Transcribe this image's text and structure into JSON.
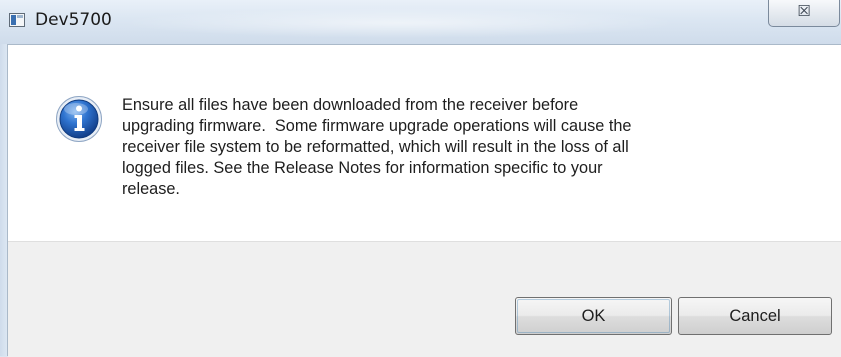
{
  "window": {
    "title": "Dev5700",
    "close_glyph": "☒",
    "app_icon": "application-window-icon"
  },
  "dialog": {
    "icon": "information-icon",
    "message": "Ensure all files have been downloaded from the receiver before\nupgrading firmware.  Some firmware upgrade operations will cause the\nreceiver file system to be reformatted, which will result in the loss of all\nlogged files. See the Release Notes for information specific to your\nrelease.",
    "buttons": {
      "ok_label": "OK",
      "cancel_label": "Cancel"
    }
  },
  "colors": {
    "info_icon_blue": "#1f5fb8",
    "button_bar": "#f0f0f0",
    "title_bar": "#dbe6f2"
  }
}
